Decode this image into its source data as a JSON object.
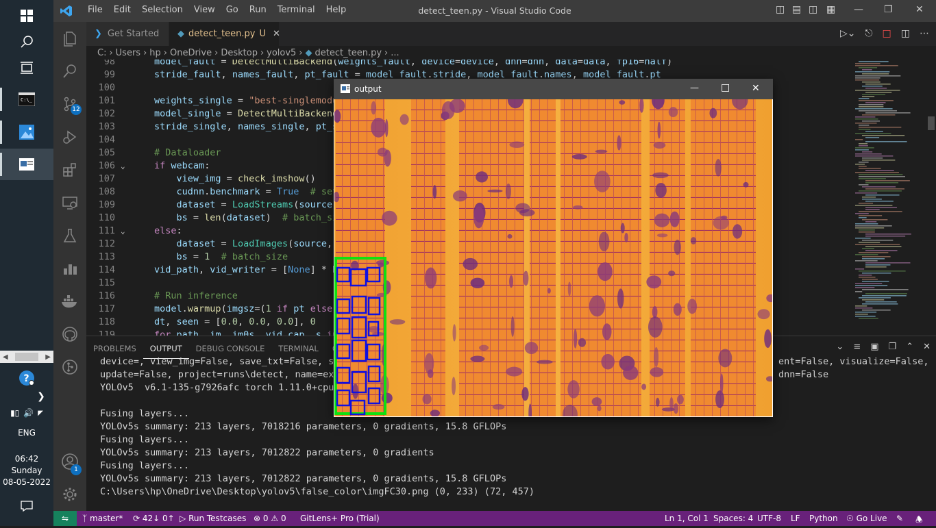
{
  "taskbar": {
    "time": "06:42",
    "day": "Sunday",
    "date": "08-05-2022",
    "language": "ENG"
  },
  "titlebar": {
    "menu": [
      "File",
      "Edit",
      "Selection",
      "View",
      "Go",
      "Run",
      "Terminal",
      "Help"
    ],
    "title": "detect_teen.py - Visual Studio Code"
  },
  "activity": {
    "scm_badge": "12",
    "account_badge": "1"
  },
  "tabs": {
    "get_started": "Get Started",
    "active_file": "detect_teen.py",
    "active_status": "U"
  },
  "breadcrumb": [
    "C:",
    "Users",
    "hp",
    "OneDrive",
    "Desktop",
    "yolov5",
    "detect_teen.py",
    "..."
  ],
  "editor": {
    "line_numbers": [
      "98",
      "99",
      "100",
      "101",
      "102",
      "103",
      "104",
      "105",
      "106",
      "107",
      "108",
      "109",
      "110",
      "111",
      "112",
      "113",
      "114",
      "115",
      "116",
      "117",
      "118",
      "119"
    ]
  },
  "panel": {
    "tabs": [
      "PROBLEMS",
      "OUTPUT",
      "DEBUG CONSOLE",
      "TERMINAL",
      "GIT"
    ],
    "active_tab": "OUTPUT",
    "lines": [
      "device=, view_img=False, save_txt=False, save",
      "update=False, project=runs\\detect, name=exp,",
      "YOLOv5  v6.1-135-g7926afc torch 1.11.0+cpu CP",
      "",
      "Fusing layers...",
      "YOLOv5s summary: 213 layers, 7018216 parameters, 0 gradients, 15.8 GFLOPs",
      "Fusing layers...",
      "YOLOv5s summary: 213 layers, 7012822 parameters, 0 gradients",
      "Fusing layers...",
      "YOLOv5s summary: 213 layers, 7012822 parameters, 0 gradients, 15.8 GFLOPs",
      "C:\\Users\\hp\\OneDrive\\Desktop\\yolov5\\false_color\\imgFC30.png (0, 233) (72, 457)"
    ],
    "right_fragment_1": "ent=False, visualize=False,",
    "right_fragment_2": "dnn=False"
  },
  "output_window": {
    "title": "output"
  },
  "status": {
    "branch": "master*",
    "sync": "42↓ 0↑",
    "run_testcases": "Run Testcases",
    "errors": "0",
    "warnings": "0",
    "gitlens": "GitLens+ Pro (Trial)",
    "position": "Ln 1, Col 1",
    "spaces": "Spaces: 4",
    "encoding": "UTF-8",
    "eol": "LF",
    "language": "Python",
    "golive": "Go Live"
  }
}
